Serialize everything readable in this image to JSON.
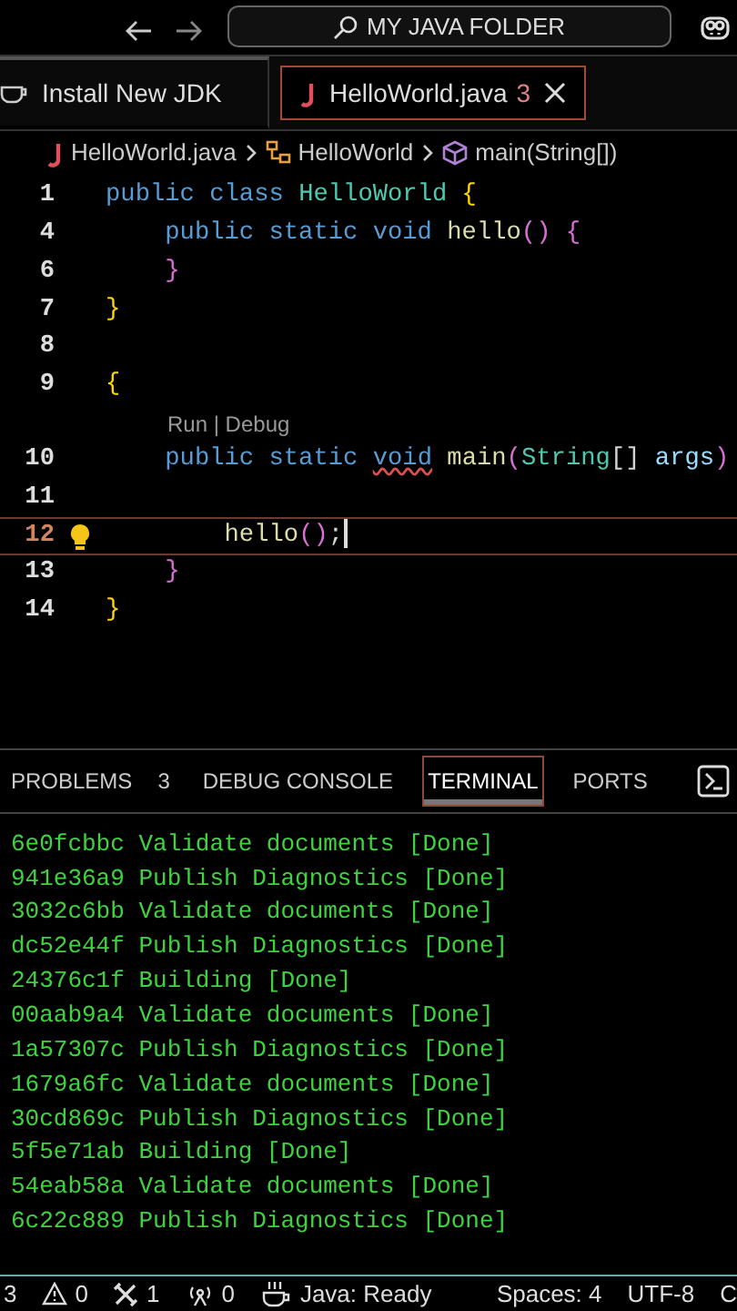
{
  "title_bar": {
    "search": "MY JAVA FOLDER"
  },
  "tabs": [
    {
      "label": "Install New JDK",
      "kind": "welcome",
      "selected": false
    },
    {
      "label": "HelloWorld.java",
      "kind": "source",
      "badge": "3",
      "selected": true
    }
  ],
  "breadcrumb": [
    {
      "label": "HelloWorld.java",
      "kind": "file"
    },
    {
      "label": "HelloWorld",
      "kind": "class"
    },
    {
      "label": "main(String[])",
      "kind": "method"
    }
  ],
  "editor": {
    "lines": [
      {
        "number": "1",
        "current": false,
        "tokens": [
          {
            "kind": "kw",
            "text": "public class"
          },
          {
            "kind": "type",
            "text": " HelloWorld"
          },
          {
            "kind": "brace",
            "text": " {"
          }
        ]
      },
      {
        "number": "4",
        "current": false,
        "tokens": [
          {
            "kind": "kw",
            "text": "    public static void"
          },
          {
            "kind": "fn",
            "text": " hello"
          },
          {
            "kind": "paren",
            "text": "() {"
          }
        ]
      },
      {
        "number": "6",
        "current": false,
        "tokens": [
          {
            "kind": "paren",
            "text": "    }"
          }
        ]
      },
      {
        "number": "7",
        "current": false,
        "tokens": [
          {
            "kind": "brace",
            "text": "}"
          }
        ]
      },
      {
        "number": "8",
        "current": false
      },
      {
        "number": "9",
        "current": false,
        "tokens": [
          {
            "kind": "brace",
            "text": "{"
          }
        ]
      },
      {
        "codelens": "Run | Debug",
        "number": "10",
        "current": false,
        "tokens": [
          {
            "kind": "kw",
            "text": "    public static"
          },
          {
            "kind": "kw",
            "text": "void",
            "error": true
          },
          {
            "kind": "fn",
            "text": " main"
          },
          {
            "kind": "paren",
            "text": "("
          },
          {
            "kind": "type",
            "text": "String"
          },
          {
            "kind": "plain",
            "text": "[]"
          },
          {
            "kind": "param",
            "text": " args"
          },
          {
            "kind": "paren",
            "text": ")"
          }
        ]
      },
      {
        "number": "11",
        "current": false
      },
      {
        "number": "12",
        "current": true,
        "lightbulb": true,
        "tokens": [
          {
            "kind": "fn",
            "text": "        hello"
          },
          {
            "kind": "paren",
            "text": "()"
          },
          {
            "kind": "plain",
            "text": ";"
          }
        ]
      },
      {
        "number": "13",
        "current": false,
        "tokens": [
          {
            "kind": "paren",
            "text": "    }"
          }
        ]
      },
      {
        "number": "14",
        "current": false,
        "tokens": [
          {
            "kind": "brace",
            "text": "}"
          }
        ]
      }
    ]
  },
  "panel": {
    "tabs": [
      {
        "label": "PROBLEMS",
        "count": "3",
        "selected": false
      },
      {
        "label": "DEBUG CONSOLE",
        "selected": false
      },
      {
        "label": "TERMINAL",
        "selected": true
      },
      {
        "label": "PORTS",
        "selected": false
      }
    ],
    "terminal": [
      "6e0fcbbc Validate documents [Done]",
      "941e36a9 Publish Diagnostics [Done]",
      "3032c6bb Validate documents [Done]",
      "dc52e44f Publish Diagnostics [Done]",
      "24376c1f Building [Done]",
      "00aab9a4 Validate documents [Done]",
      "1a57307c Publish Diagnostics [Done]",
      "1679a6fc Validate documents [Done]",
      "30cd869c Publish Diagnostics [Done]",
      "5f5e71ab Building [Done]",
      "54eab58a Validate documents [Done]",
      "6c22c889 Publish Diagnostics [Done]"
    ]
  },
  "status_bar": [
    {
      "kind": "plain",
      "text": "3"
    },
    {
      "kind": "warning",
      "text": "0"
    },
    {
      "kind": "tools",
      "text": "1"
    },
    {
      "kind": "radio",
      "text": "0"
    },
    {
      "kind": "java",
      "text": "Java: Ready"
    },
    {
      "kind": "spacer"
    },
    {
      "kind": "plain",
      "text": "Spaces: 4"
    },
    {
      "kind": "plain",
      "text": "UTF-8"
    },
    {
      "kind": "plain",
      "text": "C"
    }
  ]
}
